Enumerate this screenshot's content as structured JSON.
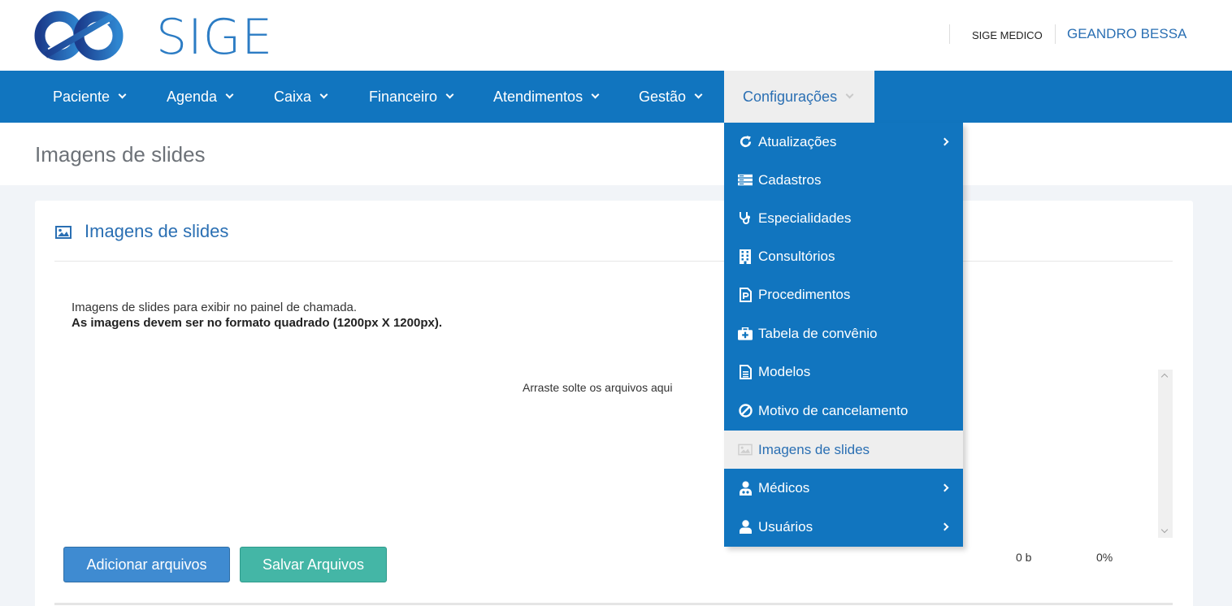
{
  "header": {
    "logo_text": "SIGE",
    "company": "SIGE MEDICO",
    "user": "GEANDRO BESSA"
  },
  "nav": {
    "items": [
      {
        "label": "Paciente"
      },
      {
        "label": "Agenda"
      },
      {
        "label": "Caixa"
      },
      {
        "label": "Financeiro"
      },
      {
        "label": "Atendimentos"
      },
      {
        "label": "Gestão"
      },
      {
        "label": "Configurações",
        "active": true
      }
    ]
  },
  "page": {
    "title": "Imagens de slides"
  },
  "card": {
    "title": "Imagens de slides",
    "description": "Imagens de slides para exibir no painel de chamada.",
    "description_bold": "As imagens devem ser no formato quadrado (1200px X 1200px).",
    "dropzone_text": "Arraste solte os arquivos aqui",
    "add_button": "Adicionar arquivos",
    "save_button": "Salvar Arquivos",
    "total_size": "0 b",
    "progress": "0%"
  },
  "dropdown": {
    "items": [
      {
        "label": "Atualizações",
        "icon": "refresh-icon",
        "submenu": true
      },
      {
        "label": "Cadastros",
        "icon": "server-icon",
        "submenu": false
      },
      {
        "label": "Especialidades",
        "icon": "stethoscope-icon",
        "submenu": false
      },
      {
        "label": "Consultórios",
        "icon": "building-icon",
        "submenu": false
      },
      {
        "label": "Procedimentos",
        "icon": "file-p-icon",
        "submenu": false
      },
      {
        "label": "Tabela de convênio",
        "icon": "medkit-icon",
        "submenu": false
      },
      {
        "label": "Modelos",
        "icon": "document-icon",
        "submenu": false
      },
      {
        "label": "Motivo de cancelamento",
        "icon": "ban-icon",
        "submenu": false
      },
      {
        "label": "Imagens de slides",
        "icon": "image-icon",
        "submenu": false,
        "active": true
      },
      {
        "label": "Médicos",
        "icon": "doctor-icon",
        "submenu": true
      },
      {
        "label": "Usuários",
        "icon": "user-icon",
        "submenu": true
      }
    ]
  },
  "colors": {
    "primary": "#1175bf",
    "link": "#2a6fb3",
    "button_add": "#3f8bd1",
    "button_save": "#44b6a6"
  }
}
